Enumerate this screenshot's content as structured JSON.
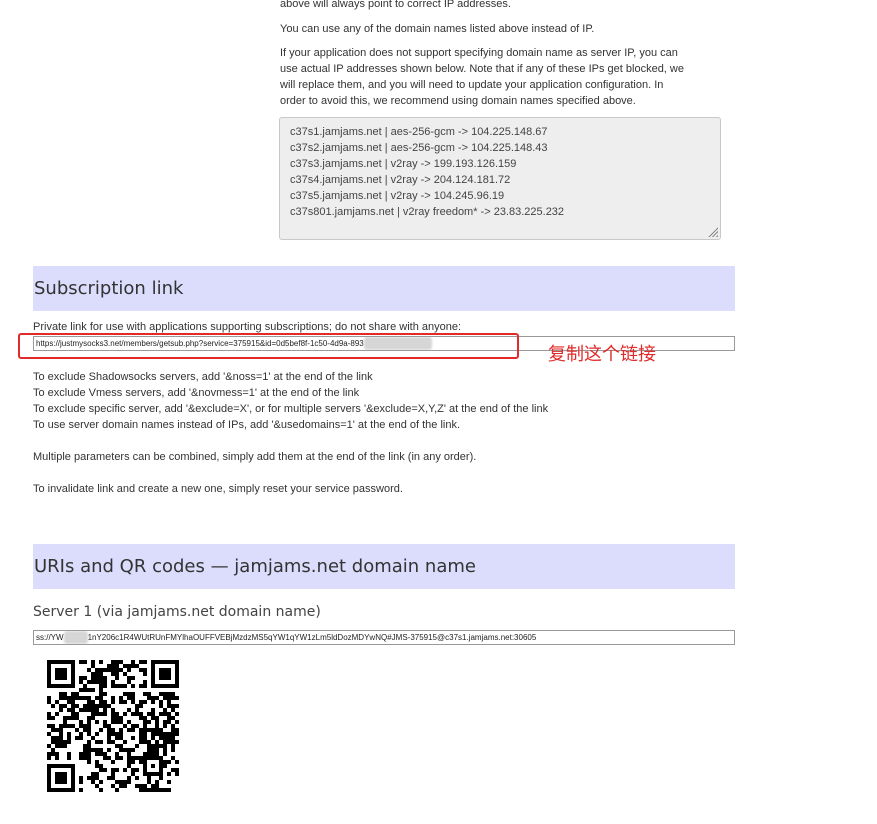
{
  "connection_info": {
    "p0": "above will always point to correct IP addresses.",
    "p1": "You can use any of the domain names listed above instead of IP.",
    "p2_l1": "If your application does not support specifying domain name as server IP, you can",
    "p2_l2": "use actual IP addresses shown below. Note that if any of these IPs get blocked, we",
    "p2_l3": "will replace them, and you will need to update your application configuration. In",
    "p2_l4": "order to avoid this, we recommend using domain names specified above.",
    "ip_list": [
      "c37s1.jamjams.net | aes-256-gcm -> 104.225.148.67",
      "c37s2.jamjams.net | aes-256-gcm -> 104.225.148.43",
      "c37s3.jamjams.net | v2ray -> 199.193.126.159",
      "c37s4.jamjams.net | v2ray -> 204.124.181.72",
      "c37s5.jamjams.net | v2ray -> 104.245.96.19",
      "c37s801.jamjams.net | v2ray freedom* -> 23.83.225.232"
    ]
  },
  "subscription": {
    "title": "Subscription link",
    "description": "Private link for use with applications supporting subscriptions; do not share with anyone:",
    "url_visible": "https://justmysocks3.net/members/getsub.php?service=375915&id=0d5bef8f-1c50-4d9a-893",
    "url_obscured": "xxxxxxxxxxxxxxxxx",
    "annotation": "复制这个链接",
    "params": [
      "To exclude Shadowsocks servers, add '&noss=1' at the end of the link",
      "To exclude Vmess servers, add '&novmess=1' at the end of the link",
      "To exclude specific server, add '&exclude=X', or for multiple servers '&exclude=X,Y,Z' at the end of the link",
      "To use server domain names instead of IPs, add '&usedomains=1' at the end of the link."
    ],
    "combine_note": "Multiple parameters can be combined, simply add them at the end of the link (in any order).",
    "invalidate_note": "To invalidate link and create a new one, simply reset your service password."
  },
  "uris": {
    "title": "URIs and QR codes — jamjams.net domain name",
    "server1_title": "Server 1 (via jamjams.net domain name)",
    "server1_uri_prefix": "ss://YW",
    "server1_uri_obscured": "xxxxxx",
    "server1_uri_rest": "1nY206c1R4WUtRUnFMYlhaOUFFVEBjMzdzMS5qYW1qYW1zLm5ldDozMDYwNQ#JMS-375915@c37s1.jamjams.net:30605",
    "qr_icon": "qr-code-icon"
  }
}
